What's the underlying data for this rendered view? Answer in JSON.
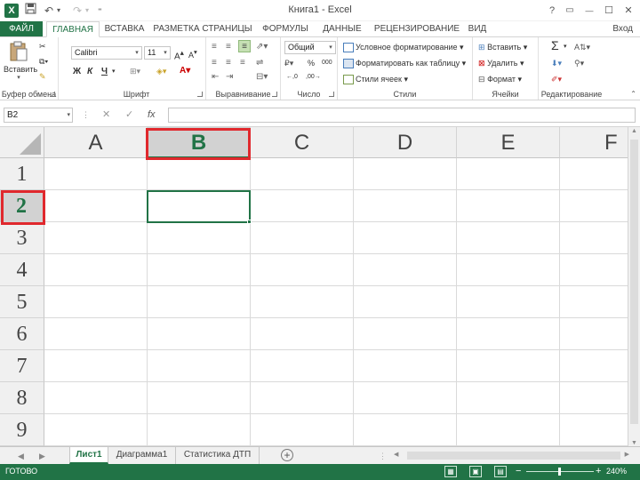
{
  "window": {
    "title": "Книга1 - Excel",
    "app_icon": "X",
    "undo": "↶",
    "redo": "↷",
    "help": "?",
    "restore": "▭",
    "minimize": "—",
    "maximize": "☐",
    "close": "✕",
    "sign_in": "Вход"
  },
  "tabs": [
    "ФАЙЛ",
    "ГЛАВНАЯ",
    "ВСТАВКА",
    "РАЗМЕТКА СТРАНИЦЫ",
    "ФОРМУЛЫ",
    "ДАННЫЕ",
    "РЕЦЕНЗИРОВАНИЕ",
    "ВИД"
  ],
  "ribbon": {
    "clipboard": {
      "paste": "Вставить",
      "label": "Буфер обмена"
    },
    "font": {
      "name": "Calibri",
      "size": "11",
      "bold": "Ж",
      "italic": "К",
      "underline": "Ч",
      "label": "Шрифт"
    },
    "alignment": {
      "label": "Выравнивание"
    },
    "number": {
      "format": "Общий",
      "percent": "%",
      "thousands": "000",
      "label": "Число"
    },
    "styles": {
      "conditional": "Условное форматирование",
      "as_table": "Форматировать как таблицу",
      "cell_styles": "Стили ячеек",
      "label": "Стили"
    },
    "cells": {
      "insert": "Вставить",
      "delete": "Удалить",
      "format": "Формат",
      "label": "Ячейки"
    },
    "editing": {
      "sum": "Σ",
      "label": "Редактирование"
    }
  },
  "formula_bar": {
    "name_box": "B2",
    "fx": "fx",
    "value": ""
  },
  "grid": {
    "columns": [
      "A",
      "B",
      "C",
      "D",
      "E",
      "F"
    ],
    "rows": [
      "1",
      "2",
      "3",
      "4",
      "5",
      "6",
      "7",
      "8",
      "9"
    ],
    "selected_column": "B",
    "selected_row": "2",
    "active_cell": "B2"
  },
  "sheets": {
    "tabs": [
      "Лист1",
      "Диаграмма1",
      "Статистика ДТП"
    ],
    "active": "Лист1",
    "add": "+"
  },
  "status": {
    "ready": "ГОТОВО",
    "zoom": "240%",
    "zoom_minus": "−",
    "zoom_plus": "+"
  },
  "colors": {
    "accent": "#217346",
    "highlight": "#e0282d"
  }
}
